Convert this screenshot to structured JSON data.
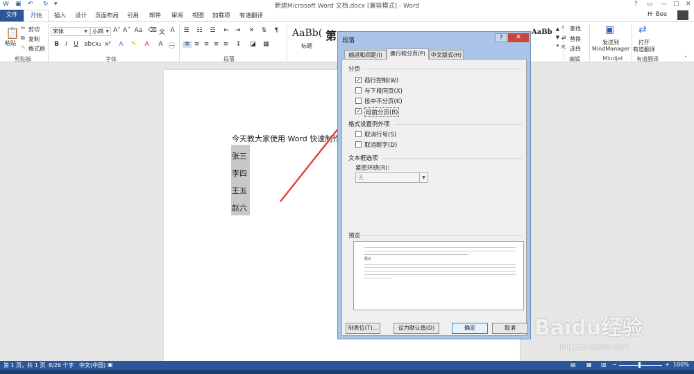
{
  "window": {
    "title": "新建Microsoft Word 文档.docx [兼容模式] - Word",
    "help": "?",
    "user": "H· Bee"
  },
  "tabs": [
    "文件",
    "开始",
    "插入",
    "设计",
    "页面布局",
    "引用",
    "邮件",
    "审阅",
    "视图",
    "加载项",
    "有道翻译"
  ],
  "ribbon": {
    "clipboard": {
      "paste": "粘贴",
      "cut": "剪切",
      "copy": "复制",
      "format_painter": "格式刷",
      "label": "剪贴板"
    },
    "font": {
      "name": "宋体",
      "size": "小四",
      "bold": "B",
      "italic": "I",
      "underline": "U",
      "label": "字体"
    },
    "paragraph": {
      "label": "段落"
    },
    "styles": {
      "sample1": "AaBb(",
      "sample2": "第",
      "caption1": "标题",
      "sample3": "AaBb"
    },
    "editing": {
      "find": "查找",
      "replace": "替换",
      "select": "选择",
      "label": "编辑"
    },
    "mindjet": {
      "send": "发送到",
      "app": "MindManager",
      "label": "Mindjet"
    },
    "youdao": {
      "open": "打开",
      "name": "有道翻译",
      "label": "有道翻译"
    }
  },
  "document": {
    "line1": "今天教大家使用 Word 快速制作",
    "names": [
      "张三",
      "李四",
      "王五",
      "赵六"
    ]
  },
  "dialog": {
    "title": "段落",
    "tabs": [
      "缩进和间距(I)",
      "换行和分页(P)",
      "中文版式(H)"
    ],
    "sections": {
      "pagination": "分页",
      "exceptions": "格式设置例外项",
      "textbox": "文本框选项",
      "preview": "预览"
    },
    "checkboxes": [
      {
        "label": "孤行控制(W)",
        "checked": true
      },
      {
        "label": "与下段同页(X)",
        "checked": false
      },
      {
        "label": "段中不分页(K)",
        "checked": false
      },
      {
        "label": "段前分页(B)",
        "checked": true
      },
      {
        "label": "取消行号(S)",
        "checked": false
      },
      {
        "label": "取消断字(D)",
        "checked": false
      }
    ],
    "tight_wrap_label": "紧密环绕(R):",
    "tight_wrap_value": "无",
    "preview_sample": "张三",
    "buttons": {
      "tabs": "制表位(T)...",
      "default": "设为默认值(D)",
      "ok": "确定",
      "cancel": "取消"
    }
  },
  "status": {
    "page": "第 1 页，共 1 页",
    "words": "8/26 个字",
    "language": "中文(中国)",
    "zoom": "100%"
  },
  "watermark": {
    "brand": "Baidu经验",
    "url": "jingyan.baidu.com"
  },
  "colors": {
    "accent": "#2b579a",
    "dialog_frame": "#a9c4e6",
    "arrow": "#e8413a"
  }
}
